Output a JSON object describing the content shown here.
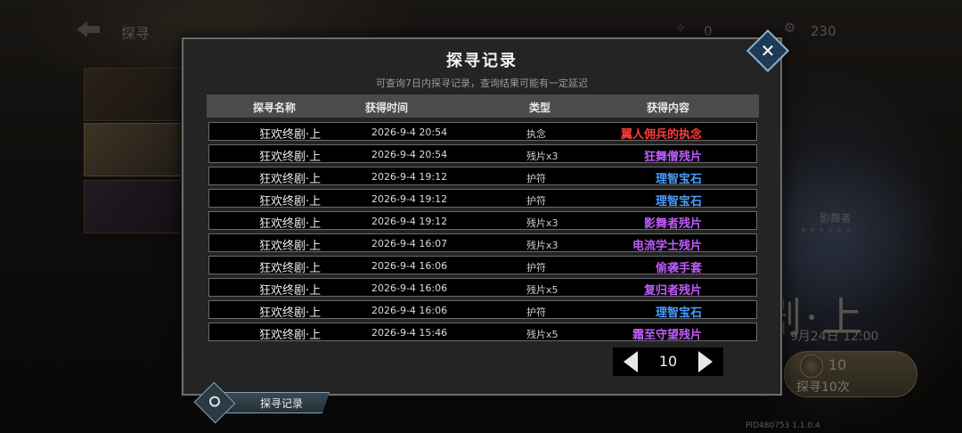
{
  "header": {
    "title": "探寻",
    "resource_a": "0",
    "resource_b": "230"
  },
  "background": {
    "hero_name": "影舞者",
    "hero_stars": "★★★★★★",
    "banner_title": "剧·上",
    "banner_date": "9月24日 12:00",
    "draw_count": "10",
    "draw_button": "探寻10次",
    "pid": "PID480753  1.1.0.4"
  },
  "modal": {
    "title": "探寻记录",
    "subtitle": "可查询7日内探寻记录，查询结果可能有一定延迟",
    "columns": [
      "探寻名称",
      "获得时间",
      "类型",
      "获得内容"
    ],
    "rows": [
      {
        "name": "狂欢终剧·上",
        "time": "2026-9-4 20:54",
        "type": "执念",
        "reward": "翼人佣兵的执念",
        "color": "#ff3b3b"
      },
      {
        "name": "狂欢终剧·上",
        "time": "2026-9-4 20:54",
        "type": "残片x3",
        "reward": "狂舞僧残片",
        "color": "#c05cff"
      },
      {
        "name": "狂欢终剧·上",
        "time": "2026-9-4 19:12",
        "type": "护符",
        "reward": "理智宝石",
        "color": "#4a9cff"
      },
      {
        "name": "狂欢终剧·上",
        "time": "2026-9-4 19:12",
        "type": "护符",
        "reward": "理智宝石",
        "color": "#4a9cff"
      },
      {
        "name": "狂欢终剧·上",
        "time": "2026-9-4 19:12",
        "type": "残片x3",
        "reward": "影舞者残片",
        "color": "#c05cff"
      },
      {
        "name": "狂欢终剧·上",
        "time": "2026-9-4 16:07",
        "type": "残片x3",
        "reward": "电流学士残片",
        "color": "#c05cff"
      },
      {
        "name": "狂欢终剧·上",
        "time": "2026-9-4 16:06",
        "type": "护符",
        "reward": "偷袭手套",
        "color": "#c05cff"
      },
      {
        "name": "狂欢终剧·上",
        "time": "2026-9-4 16:06",
        "type": "残片x5",
        "reward": "复归者残片",
        "color": "#c05cff"
      },
      {
        "name": "狂欢终剧·上",
        "time": "2026-9-4 16:06",
        "type": "护符",
        "reward": "理智宝石",
        "color": "#4a9cff"
      },
      {
        "name": "狂欢终剧·上",
        "time": "2026-9-4 15:46",
        "type": "残片x5",
        "reward": "霜至守望残片",
        "color": "#c05cff"
      }
    ],
    "page": "10",
    "close_icon": "close-icon"
  },
  "bottom_tab": {
    "label": "探寻记录",
    "icon": "magnifier-icon"
  }
}
